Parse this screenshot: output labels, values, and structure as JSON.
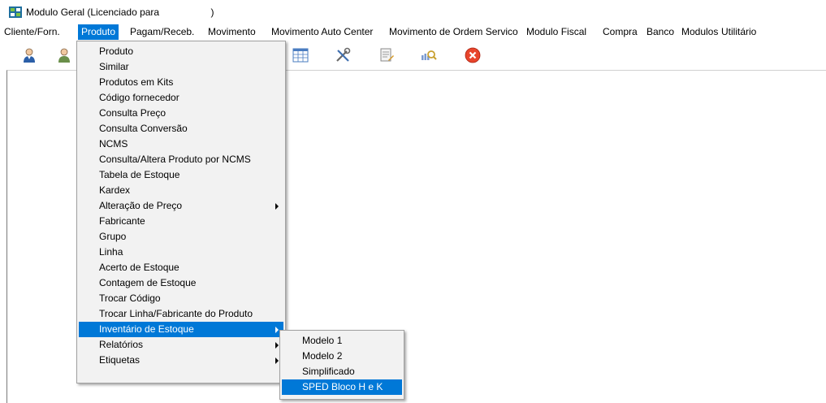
{
  "window": {
    "title": "Modulo Geral (Licenciado para                   )"
  },
  "menubar": {
    "items": [
      {
        "label": "Cliente/Forn."
      },
      {
        "label": "Produto"
      },
      {
        "label": "Pagam/Receb."
      },
      {
        "label": "Movimento"
      },
      {
        "label": "Movimento Auto Center"
      },
      {
        "label": "Movimento de Ordem Servico"
      },
      {
        "label": "Modulo Fiscal"
      },
      {
        "label": "Compra"
      },
      {
        "label": "Banco"
      },
      {
        "label": "Modulos"
      },
      {
        "label": "Utilitário"
      }
    ]
  },
  "toolbar": {
    "icons": [
      "person-icon",
      "people-icon",
      "grid-table-icon",
      "tools-icon",
      "document-edit-icon",
      "magnify-report-icon",
      "exit-close-icon"
    ]
  },
  "produto_menu": {
    "items": [
      {
        "label": "Produto"
      },
      {
        "label": "Similar"
      },
      {
        "label": "Produtos em Kits"
      },
      {
        "label": "Código fornecedor"
      },
      {
        "label": "Consulta Preço"
      },
      {
        "label": "Consulta Conversão"
      },
      {
        "label": "NCMS"
      },
      {
        "label": "Consulta/Altera Produto por NCMS"
      },
      {
        "label": "Tabela de Estoque"
      },
      {
        "label": "Kardex"
      },
      {
        "label": "Alteração de Preço"
      },
      {
        "label": "Fabricante"
      },
      {
        "label": "Grupo"
      },
      {
        "label": "Linha"
      },
      {
        "label": "Acerto de Estoque"
      },
      {
        "label": "Contagem de Estoque"
      },
      {
        "label": "Trocar Código"
      },
      {
        "label": "Trocar Linha/Fabricante do Produto"
      },
      {
        "label": "Inventário de Estoque"
      },
      {
        "label": "Relatórios"
      },
      {
        "label": "Etiquetas"
      }
    ]
  },
  "inventario_submenu": {
    "items": [
      {
        "label": "Modelo 1"
      },
      {
        "label": "Modelo 2"
      },
      {
        "label": "Simplificado"
      },
      {
        "label": "SPED Bloco H e K"
      }
    ]
  },
  "colors": {
    "highlight": "#0078d7",
    "menu_bg": "#f2f2f2",
    "menu_border": "#a0a0a0"
  }
}
